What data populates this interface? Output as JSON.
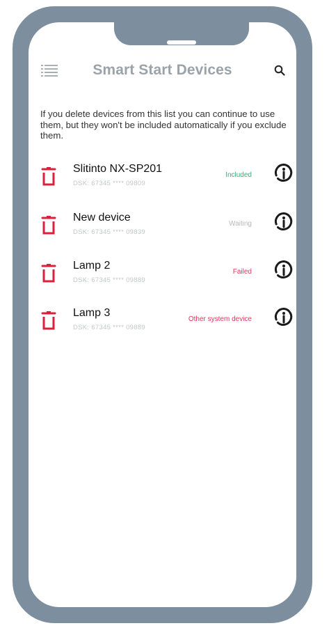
{
  "header": {
    "title": "Smart Start Devices",
    "menu_icon": "list-menu-icon",
    "search_icon": "search-icon"
  },
  "intro_text": "If you delete devices from this list you can continue to use them, but they won't be included automatically if you exclude them.",
  "devices": [
    {
      "name": "Slitinto NX-SP201",
      "dsk": "DSK: 67345 **** 09809",
      "status": "Included",
      "status_color": "#39b17a"
    },
    {
      "name": "New device",
      "dsk": "DSK: 67345 **** 09839",
      "status": "Waiting",
      "status_color": "#b8b8b8"
    },
    {
      "name": "Lamp 2",
      "dsk": "DSK: 67345 **** 09889",
      "status": "Failed",
      "status_color": "#e1365a"
    },
    {
      "name": "Lamp 3",
      "dsk": "DSK: 67345 **** 09889",
      "status": "Other system device",
      "status_color": "#e1365a"
    }
  ],
  "colors": {
    "frame": "#7d8e9e",
    "trash": "#d9203c",
    "title": "#9aa3aa"
  }
}
